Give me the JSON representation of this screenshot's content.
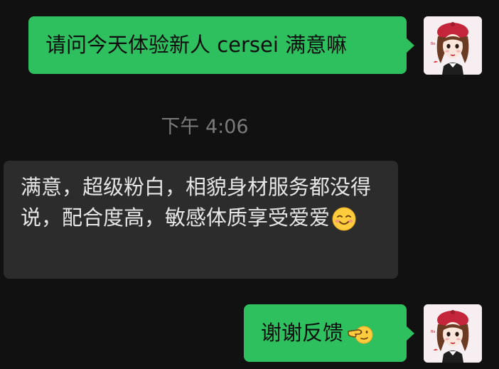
{
  "messages": [
    {
      "direction": "outgoing",
      "text": "请问今天体验新人 cersei 满意嘛",
      "avatar_icon": "cartoon-girl-avatar-icon"
    },
    {
      "direction": "system",
      "text": "下午 4:06"
    },
    {
      "direction": "incoming",
      "text": "满意，超级粉白，相貌身材服务都没得说，配合度高，敏感体质享受爱爱",
      "emoji_icon": "smiling-face-icon"
    },
    {
      "direction": "outgoing",
      "text": "谢谢反馈",
      "emoji_icon": "pointing-hand-icon",
      "avatar_icon": "cartoon-girl-avatar-icon"
    }
  ],
  "colors": {
    "background": "#111111",
    "outgoing_bubble": "#2ec05f",
    "incoming_bubble": "#2c2c2c",
    "timestamp_text": "#7a7a7a"
  }
}
